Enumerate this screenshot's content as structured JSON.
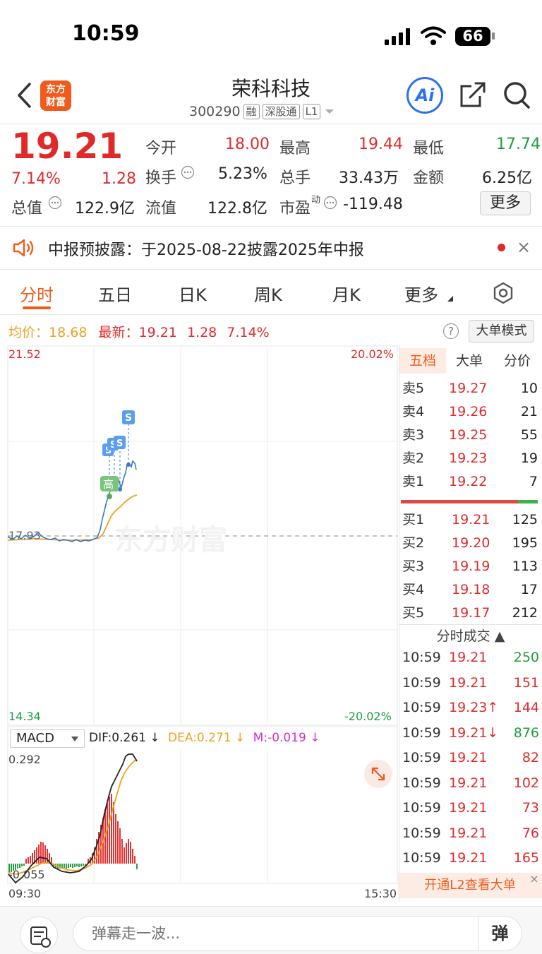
{
  "status_bar": {
    "time": "10:59",
    "battery": "66"
  },
  "header": {
    "logo_text": "东方财富",
    "stock_name": "荣科科技",
    "stock_code": "300290",
    "tags": [
      "融",
      "深股通",
      "L1"
    ],
    "ai_label": "Ai"
  },
  "quote": {
    "price": "19.21",
    "change_pct": "7.14%",
    "change": "1.28",
    "open_label": "今开",
    "open": "18.00",
    "high_label": "最高",
    "high": "19.44",
    "low_label": "最低",
    "low": "17.74",
    "turnover_label": "换手",
    "turnover": "5.23%",
    "volume_label": "总手",
    "volume": "33.43万",
    "amount_label": "金额",
    "amount": "6.25亿",
    "mktcap_label": "总值",
    "mktcap": "122.9亿",
    "float_label": "流值",
    "float_cap": "122.8亿",
    "pe_label": "市盈",
    "pe_sup": "动",
    "pe": "-119.48",
    "more_label": "更多"
  },
  "announcement": {
    "text": "中报预披露：于2025-08-22披露2025年中报",
    "close": "×"
  },
  "tabs": [
    "分时",
    "五日",
    "日K",
    "周K",
    "月K",
    "更多"
  ],
  "info": {
    "avg_label": "均价：",
    "avg": "18.68",
    "latest_label": "最新：",
    "latest": "19.21",
    "latest_chg": "1.28",
    "latest_pct": "7.14%",
    "help": "?",
    "big_order_mode": "大单模式"
  },
  "chart": {
    "y_max": "21.52",
    "y_min": "14.34",
    "y_ref": "17.93",
    "pct_max": "20.02%",
    "pct_min": "-20.02%",
    "watermark": "东方财富",
    "x_start": "09:30",
    "x_end": "15:30",
    "high_marker": "高",
    "trade_marker": "S"
  },
  "macd": {
    "selector": "MACD",
    "dif_label": "DIF:",
    "dif": "0.261",
    "dea_label": "DEA:",
    "dea": "0.271",
    "m_label": "M:",
    "m": "-0.019",
    "arrow": "↓",
    "y_max": "0.292",
    "y_min": "-0.055"
  },
  "panel_tabs": [
    "五档",
    "大单",
    "分价"
  ],
  "order_book": {
    "asks": [
      {
        "label": "卖5",
        "price": "19.27",
        "vol": "10"
      },
      {
        "label": "卖4",
        "price": "19.26",
        "vol": "21"
      },
      {
        "label": "卖3",
        "price": "19.25",
        "vol": "55"
      },
      {
        "label": "卖2",
        "price": "19.23",
        "vol": "19"
      },
      {
        "label": "卖1",
        "price": "19.22",
        "vol": "7"
      }
    ],
    "bids": [
      {
        "label": "买1",
        "price": "19.21",
        "vol": "125"
      },
      {
        "label": "买2",
        "price": "19.20",
        "vol": "195"
      },
      {
        "label": "买3",
        "price": "19.19",
        "vol": "113"
      },
      {
        "label": "买4",
        "price": "19.18",
        "vol": "17"
      },
      {
        "label": "买5",
        "price": "19.17",
        "vol": "212"
      }
    ]
  },
  "trades_header": "分时成交 ▲",
  "trades": [
    {
      "time": "10:59",
      "price": "19.21",
      "vol": "250",
      "color": "#1e9e3a"
    },
    {
      "time": "10:59",
      "price": "19.21",
      "vol": "151",
      "color": "#e02a2a"
    },
    {
      "time": "10:59",
      "price": "19.23↑",
      "vol": "144",
      "color": "#e02a2a"
    },
    {
      "time": "10:59",
      "price": "19.21↓",
      "vol": "876",
      "color": "#1e9e3a"
    },
    {
      "time": "10:59",
      "price": "19.21",
      "vol": "82",
      "color": "#e02a2a"
    },
    {
      "time": "10:59",
      "price": "19.21",
      "vol": "102",
      "color": "#e02a2a"
    },
    {
      "time": "10:59",
      "price": "19.21",
      "vol": "73",
      "color": "#e02a2a"
    },
    {
      "time": "10:59",
      "price": "19.21",
      "vol": "76",
      "color": "#e02a2a"
    },
    {
      "time": "10:59",
      "price": "19.21",
      "vol": "165",
      "color": "#e02a2a"
    }
  ],
  "l2_banner": "开通L2查看大单",
  "bottom": {
    "placeholder": "弹幕走一波...",
    "danmu_label": "弹"
  },
  "colors": {
    "up": "#e02a2a",
    "down": "#1e9e3a",
    "accent": "#ef5b1c",
    "price_line": "#3a78c9",
    "avg_line": "#f0a020"
  }
}
